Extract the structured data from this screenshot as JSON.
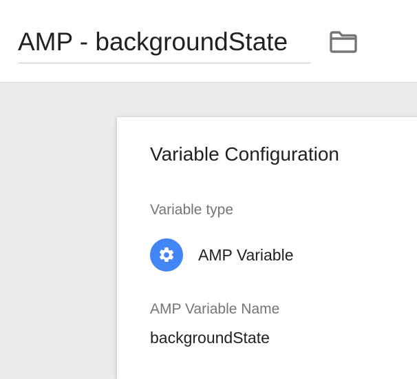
{
  "header": {
    "title": "AMP - backgroundState",
    "folder_icon": "folder-icon"
  },
  "card": {
    "title": "Variable Configuration",
    "variable_type_label": "Variable type",
    "variable_type_value": "AMP Variable",
    "variable_type_icon": "gear-icon",
    "variable_type_icon_color": "#4285f4",
    "amp_name_label": "AMP Variable Name",
    "amp_name_value": "backgroundState"
  }
}
